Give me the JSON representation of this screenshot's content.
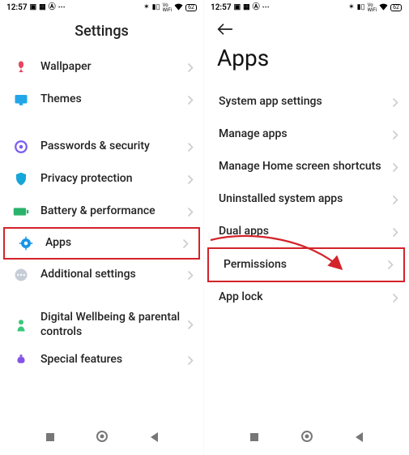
{
  "status": {
    "time": "12:57",
    "battery": "62"
  },
  "left": {
    "title": "Settings",
    "items": [
      {
        "label": "Wallpaper"
      },
      {
        "label": "Themes"
      },
      {
        "label": "Passwords & security"
      },
      {
        "label": "Privacy protection"
      },
      {
        "label": "Battery & performance"
      },
      {
        "label": "Apps"
      },
      {
        "label": "Additional settings"
      },
      {
        "label": "Digital Wellbeing & parental controls"
      },
      {
        "label": "Special features"
      }
    ]
  },
  "right": {
    "title": "Apps",
    "items": [
      {
        "label": "System app settings"
      },
      {
        "label": "Manage apps"
      },
      {
        "label": "Manage Home screen shortcuts"
      },
      {
        "label": "Uninstalled system apps"
      },
      {
        "label": "Dual apps"
      },
      {
        "label": "Permissions"
      },
      {
        "label": "App lock"
      }
    ]
  },
  "colors": {
    "highlight": "#d4232a"
  }
}
